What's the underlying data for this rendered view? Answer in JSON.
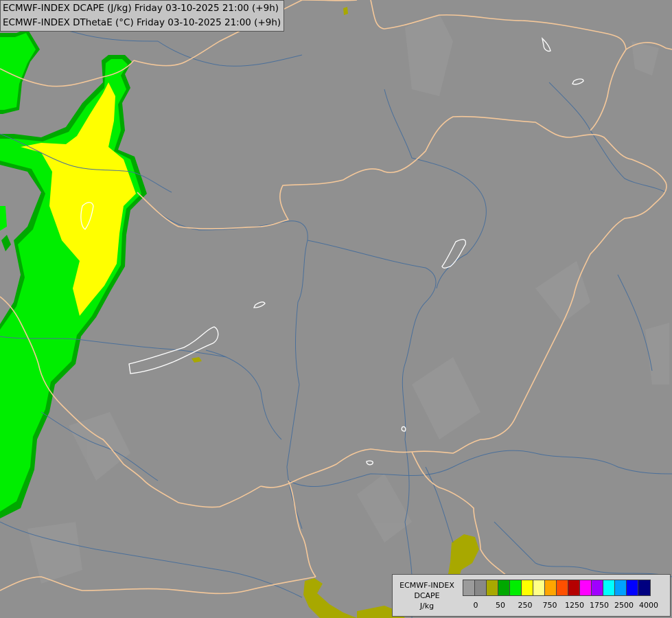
{
  "title": {
    "line1": "ECMWF-INDEX DCAPE (J/kg) Friday 03-10-2025 21:00 (+9h)",
    "line2": "ECMWF-INDEX DThetaE (°C) Friday 03-10-2025 21:00 (+9h)"
  },
  "legend": {
    "line1": "ECMWF-INDEX",
    "line2": "DCAPE",
    "line3": "J/kg",
    "colors": [
      "#9b9b9b",
      "#888888",
      "#a8a800",
      "#00a800",
      "#00ee00",
      "#ffff00",
      "#ffff88",
      "#ffa500",
      "#ff5000",
      "#b40000",
      "#ff00ff",
      "#a000ff",
      "#00ffff",
      "#00a0ff",
      "#0000ff",
      "#000080"
    ],
    "tick_labels": [
      {
        "label": "0",
        "index": 1
      },
      {
        "label": "50",
        "index": 3
      },
      {
        "label": "250",
        "index": 5
      },
      {
        "label": "750",
        "index": 7
      },
      {
        "label": "1250",
        "index": 9
      },
      {
        "label": "1750",
        "index": 11
      },
      {
        "label": "2500",
        "index": 13
      },
      {
        "label": "4000",
        "index": 15
      }
    ]
  },
  "colors": {
    "background": "#909090",
    "border": "#f5c89a",
    "river": "#4a6f9a",
    "lake": "#ffffff",
    "field_green_dark": "#00a800",
    "field_green": "#00ee00",
    "field_yellow": "#ffff00",
    "field_olive": "#a8a800"
  }
}
